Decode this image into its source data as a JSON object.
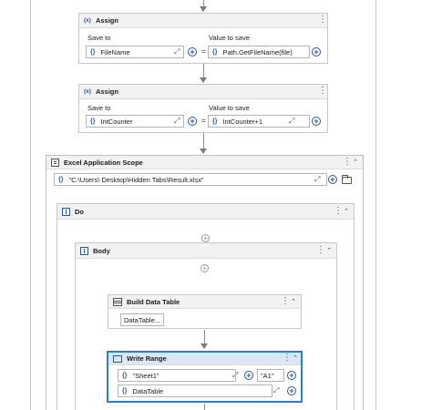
{
  "assign1": {
    "title": "Assign",
    "icon": "x-icon",
    "save_to_label": "Save to",
    "value_label": "Value to save",
    "save_to_value": "FileName",
    "value_value": "Path.GetFileName(file)",
    "equals": "="
  },
  "assign2": {
    "title": "Assign",
    "icon": "x-icon",
    "save_to_label": "Save to",
    "value_label": "Value to save",
    "save_to_value": "IntCounter",
    "value_value": "IntCounter+1",
    "equals": "="
  },
  "excel_scope": {
    "title": "Excel Application Scope",
    "path_value": "\"C:\\Users\\              Desktop\\Hidden Tabs\\Result.xlsx\""
  },
  "do_block": {
    "title": "Do"
  },
  "body_block": {
    "title": "Body"
  },
  "build_data_table": {
    "title": "Build Data Table",
    "button_label": "DataTable..."
  },
  "write_range": {
    "title": "Write Range",
    "sheet_value": "\"Sheet1\"",
    "cell_value": "\"A1\"",
    "datatable_value": "DataTable"
  },
  "glyphs": {
    "brace": "{}",
    "x_icon": "(x)",
    "dots": "⋮",
    "collapse": "⌃",
    "expand": "⤢",
    "plus": "+"
  },
  "colors": {
    "accent": "#2b5797",
    "selected_border": "#2b7cd3",
    "header_bg": "#f2f2f2"
  }
}
